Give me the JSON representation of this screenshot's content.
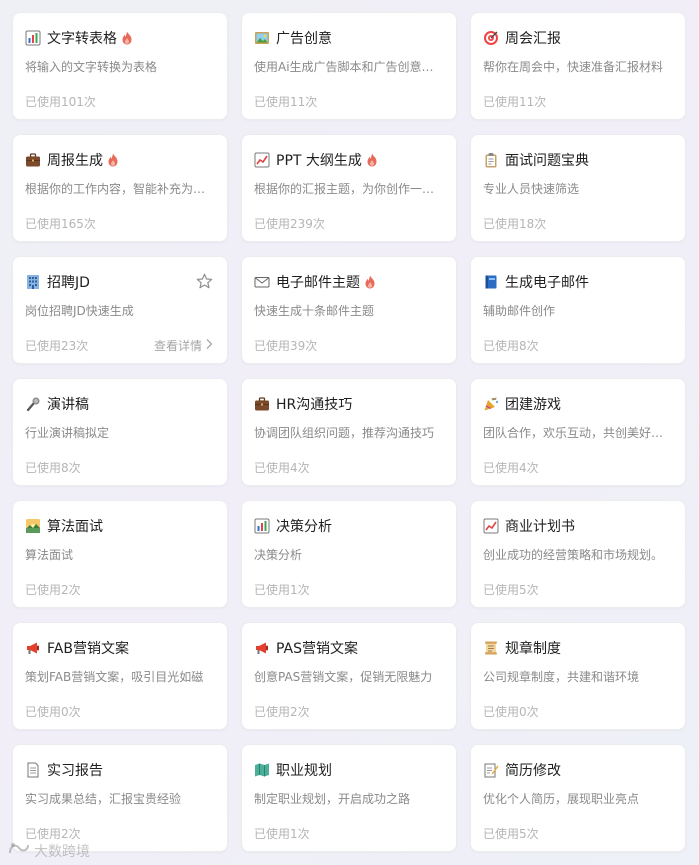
{
  "cards": [
    {
      "title": "文字转表格",
      "icon": "bar-chart-icon",
      "hot": true,
      "desc": "将输入的文字转换为表格",
      "usage": "已使用101次"
    },
    {
      "title": "广告创意",
      "icon": "picture-icon",
      "hot": false,
      "desc": "使用Ai生成广告脚本和广告创意想法",
      "usage": "已使用11次"
    },
    {
      "title": "周会汇报",
      "icon": "target-icon",
      "hot": false,
      "desc": "帮你在周会中，快速准备汇报材料",
      "usage": "已使用11次"
    },
    {
      "title": "周报生成",
      "icon": "briefcase-icon",
      "hot": true,
      "desc": "根据你的工作内容，智能补充为完整的周报",
      "usage": "已使用165次"
    },
    {
      "title": "PPT 大纲生成",
      "icon": "line-chart-icon",
      "hot": true,
      "desc": "根据你的汇报主题，为你创作一份PPT大纲",
      "usage": "已使用239次"
    },
    {
      "title": "面试问题宝典",
      "icon": "clipboard-icon",
      "hot": false,
      "desc": "专业人员快速筛选",
      "usage": "已使用18次"
    },
    {
      "title": "招聘JD",
      "icon": "office-building-icon",
      "hot": false,
      "desc": "岗位招聘JD快速生成",
      "usage": "已使用23次",
      "detail": "查看详情",
      "starred": true
    },
    {
      "title": "电子邮件主题",
      "icon": "envelope-icon",
      "hot": true,
      "desc": "快速生成十条邮件主题",
      "usage": "已使用39次"
    },
    {
      "title": "生成电子邮件",
      "icon": "book-icon",
      "hot": false,
      "desc": "辅助邮件创作",
      "usage": "已使用8次"
    },
    {
      "title": "演讲稿",
      "icon": "microphone-icon",
      "hot": false,
      "desc": "行业演讲稿拟定",
      "usage": "已使用8次"
    },
    {
      "title": "HR沟通技巧",
      "icon": "briefcase-icon",
      "hot": false,
      "desc": "协调团队组织问题，推荐沟通技巧",
      "usage": "已使用4次"
    },
    {
      "title": "团建游戏",
      "icon": "party-popper-icon",
      "hot": false,
      "desc": "团队合作，欢乐互动，共创美好回忆",
      "usage": "已使用4次"
    },
    {
      "title": "算法面试",
      "icon": "sunrise-icon",
      "hot": false,
      "desc": "算法面试",
      "usage": "已使用2次"
    },
    {
      "title": "决策分析",
      "icon": "bar-chart-icon",
      "hot": false,
      "desc": "决策分析",
      "usage": "已使用1次"
    },
    {
      "title": "商业计划书",
      "icon": "line-chart-icon",
      "hot": false,
      "desc": "创业成功的经营策略和市场规划。",
      "usage": "已使用5次"
    },
    {
      "title": "FAB营销文案",
      "icon": "megaphone-icon",
      "hot": false,
      "desc": "策划FAB营销文案，吸引目光如磁",
      "usage": "已使用0次"
    },
    {
      "title": "PAS营销文案",
      "icon": "megaphone-icon",
      "hot": false,
      "desc": "创意PAS营销文案，促销无限魅力",
      "usage": "已使用2次"
    },
    {
      "title": "规章制度",
      "icon": "scroll-icon",
      "hot": false,
      "desc": "公司规章制度，共建和谐环境",
      "usage": "已使用0次"
    },
    {
      "title": "实习报告",
      "icon": "page-icon",
      "hot": false,
      "desc": "实习成果总结，汇报宝贵经验",
      "usage": "已使用2次"
    },
    {
      "title": "职业规划",
      "icon": "map-icon",
      "hot": false,
      "desc": "制定职业规划，开启成功之路",
      "usage": "已使用1次"
    },
    {
      "title": "简历修改",
      "icon": "memo-icon",
      "hot": false,
      "desc": "优化个人简历，展现职业亮点",
      "usage": "已使用5次"
    }
  ],
  "watermark": "大数跨境",
  "colors": {
    "accent_fire": "#e86a5a",
    "card_bg": "#ffffff",
    "usage_text": "#b5b5b5"
  }
}
